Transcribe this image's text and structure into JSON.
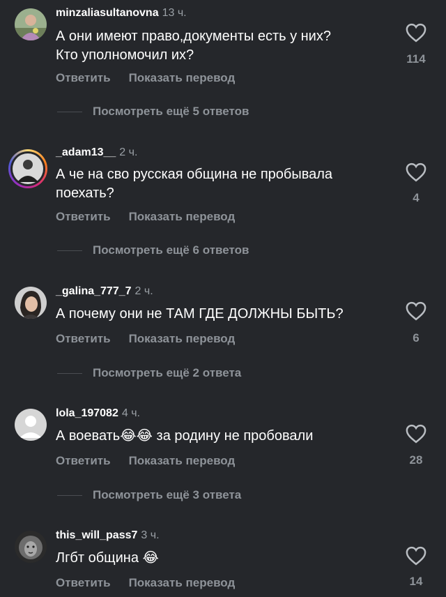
{
  "comments": [
    {
      "username": "minzaliasultanovna",
      "time": "13 ч.",
      "text_lines": [
        "А они имеют право,документы есть у них?",
        "Кто уполномочил их?"
      ],
      "likes": "114",
      "reply_label": "Ответить",
      "translate_label": "Показать перевод",
      "more_replies": "Посмотреть ещё 5 ответов",
      "avatar_icon": "user-photo-avatar"
    },
    {
      "username": "_adam13__",
      "time": "2 ч.",
      "text_lines": [
        "А че на сво русская община не пробывала",
        "поехать?"
      ],
      "likes": "4",
      "reply_label": "Ответить",
      "translate_label": "Показать перевод",
      "more_replies": "Посмотреть ещё 6 ответов",
      "avatar_icon": "user-photo-avatar-story-ring"
    },
    {
      "username": "_galina_777_7",
      "time": "2 ч.",
      "text_lines": [
        "А почему они не ТАМ ГДЕ ДОЛЖНЫ БЫТЬ?"
      ],
      "likes": "6",
      "reply_label": "Ответить",
      "translate_label": "Показать перевод",
      "more_replies": "Посмотреть ещё 2 ответа",
      "avatar_icon": "user-photo-avatar"
    },
    {
      "username": "lola_197082",
      "time": "4 ч.",
      "text_before_emoji": "А воевать",
      "emoji": "😂😂",
      "text_after_emoji": " за родину не пробовали",
      "likes": "28",
      "reply_label": "Ответить",
      "translate_label": "Показать перевод",
      "more_replies": "Посмотреть ещё 3 ответа",
      "avatar_icon": "default-user-avatar"
    },
    {
      "username": "this_will_pass7",
      "time": "3 ч.",
      "text_before_emoji": "Лгбт община ",
      "emoji": "😂",
      "likes": "14",
      "reply_label": "Ответить",
      "translate_label": "Показать перевод",
      "avatar_icon": "lion-photo-avatar"
    }
  ],
  "colors": {
    "background": "#25272b",
    "text_primary": "#ffffff",
    "text_secondary": "#8e9399"
  }
}
